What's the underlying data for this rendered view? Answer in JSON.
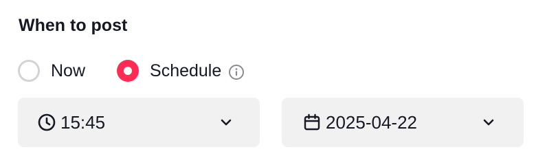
{
  "section": {
    "title": "When to post"
  },
  "post_timing": {
    "options": [
      {
        "label": "Now",
        "selected": false
      },
      {
        "label": "Schedule",
        "selected": true
      }
    ],
    "info_icon": "info-icon"
  },
  "schedule": {
    "time": {
      "value": "15:45",
      "icon": "clock-icon"
    },
    "date": {
      "value": "2025-04-22",
      "icon": "calendar-icon"
    }
  },
  "colors": {
    "accent": "#fe2c55",
    "text": "#161823",
    "field_bg": "#f1f1f2",
    "radio_off_border": "#d3d3d6",
    "muted_icon": "#8a8b91"
  }
}
